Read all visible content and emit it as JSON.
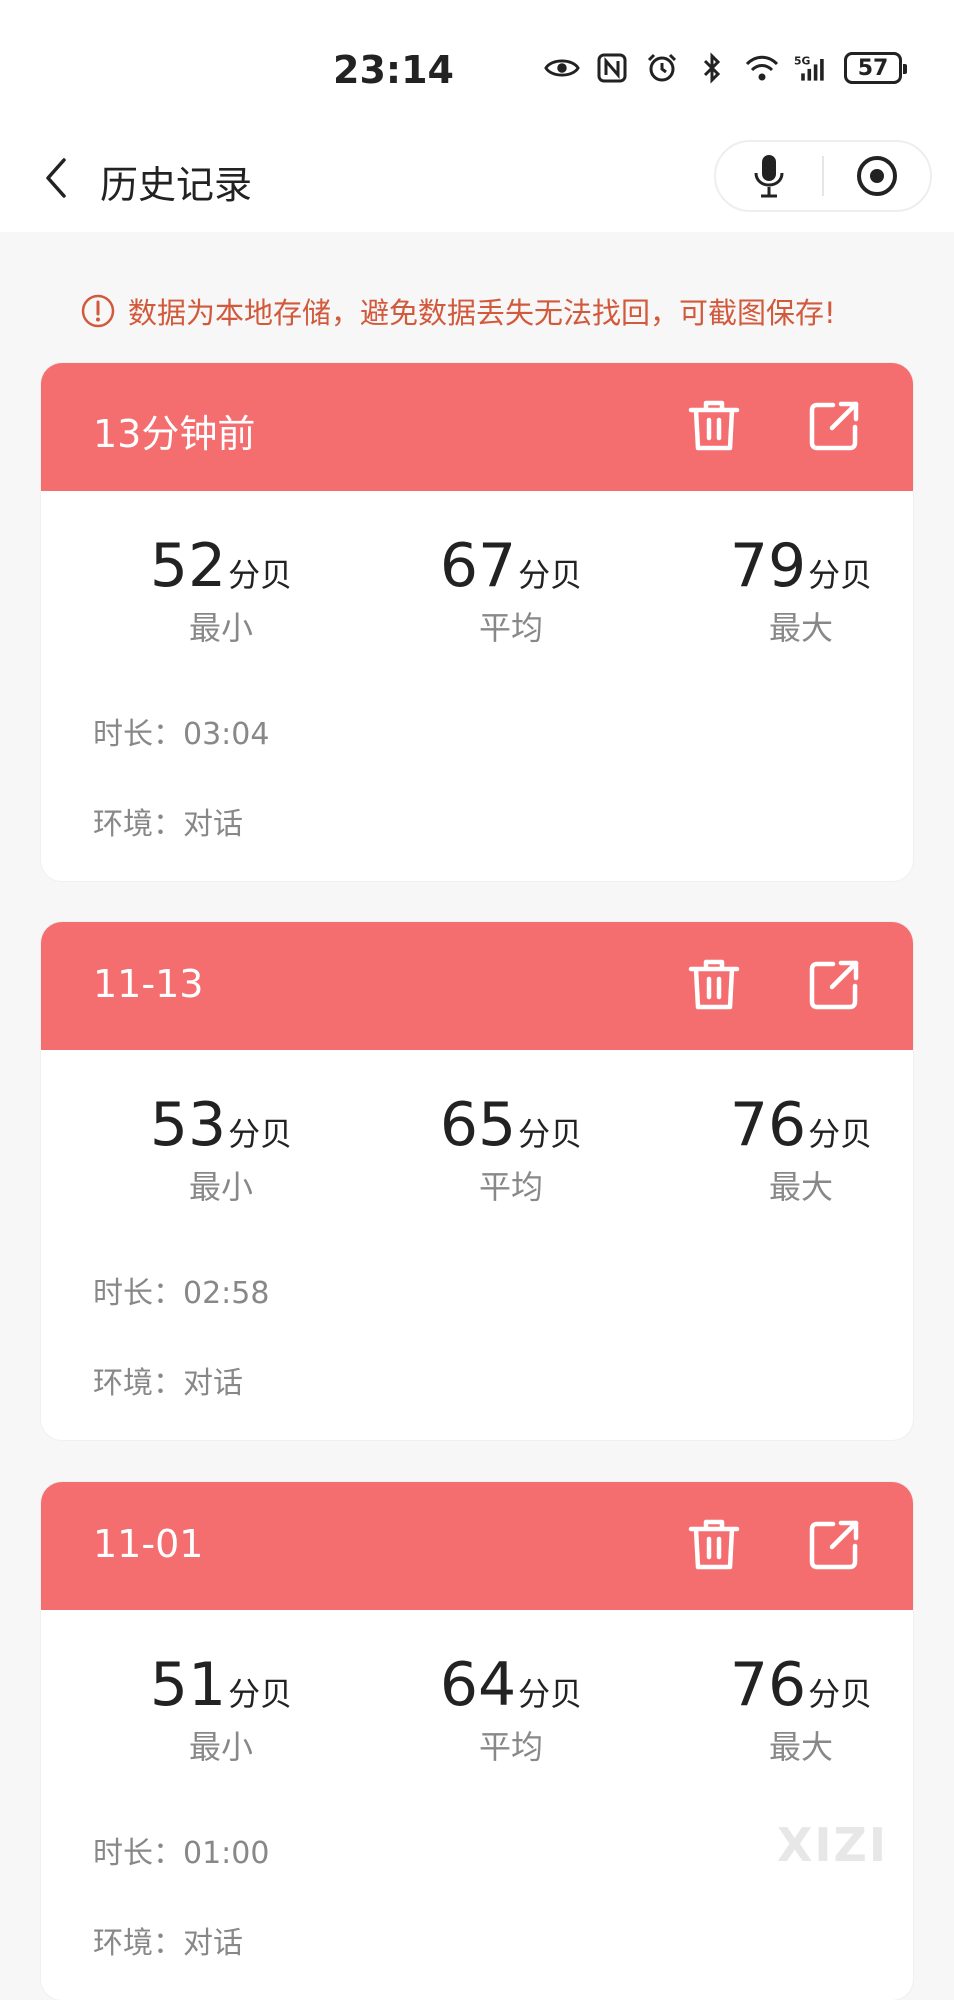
{
  "status_bar": {
    "time": "23:14",
    "battery": "57",
    "icons": [
      "eye-icon",
      "nfc-icon",
      "alarm-icon",
      "bluetooth-icon",
      "wifi-icon",
      "signal-5g-icon"
    ]
  },
  "header": {
    "title": "历史记录"
  },
  "notice": {
    "text": "数据为本地存储，避免数据丢失无法找回，可截图保存!"
  },
  "theme": {
    "accent": "#f46e70",
    "notice_color": "#d25a3c"
  },
  "labels": {
    "unit": "分贝",
    "min": "最小",
    "avg": "平均",
    "max": "最大",
    "duration_key": "时长：",
    "env_key": "环境："
  },
  "records": [
    {
      "date": "13分钟前",
      "min": "52",
      "avg": "67",
      "max": "79",
      "duration": "03:04",
      "environment": "对话"
    },
    {
      "date": "11-13",
      "min": "53",
      "avg": "65",
      "max": "76",
      "duration": "02:58",
      "environment": "对话"
    },
    {
      "date": "11-01",
      "min": "51",
      "avg": "64",
      "max": "76",
      "duration": "01:00",
      "environment": "对话"
    }
  ],
  "watermark": "XIZI"
}
